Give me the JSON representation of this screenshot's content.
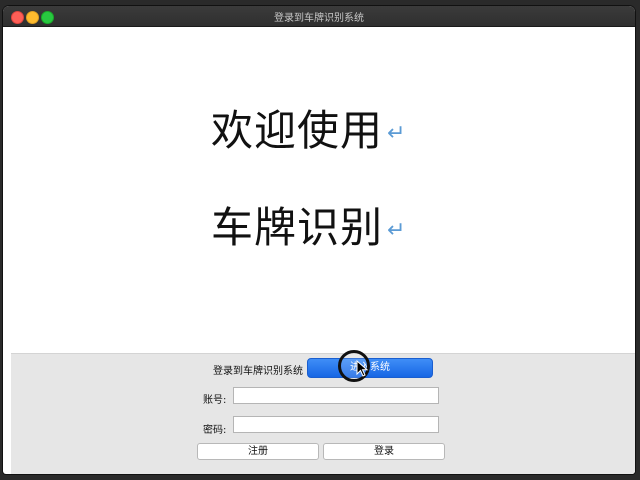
{
  "window": {
    "title": "登录到车牌识别系统"
  },
  "document": {
    "line1": "欢迎使用",
    "line2": "车牌识别",
    "return_mark": "↵"
  },
  "login_panel": {
    "title_label": "登录到车牌识别系统",
    "enter_button": "进入系统",
    "account_label": "账号:",
    "account_value": "",
    "password_label": "密码:",
    "password_value": "",
    "register_button": "注册",
    "login_button": "登录"
  },
  "colors": {
    "accent_button": "#1766e4",
    "panel_background": "#e6e6e6",
    "return_mark": "#5b9bd5"
  },
  "icons": {
    "cursor": "pointer-arrow-icon",
    "click_indicator": "click-ring-icon"
  }
}
